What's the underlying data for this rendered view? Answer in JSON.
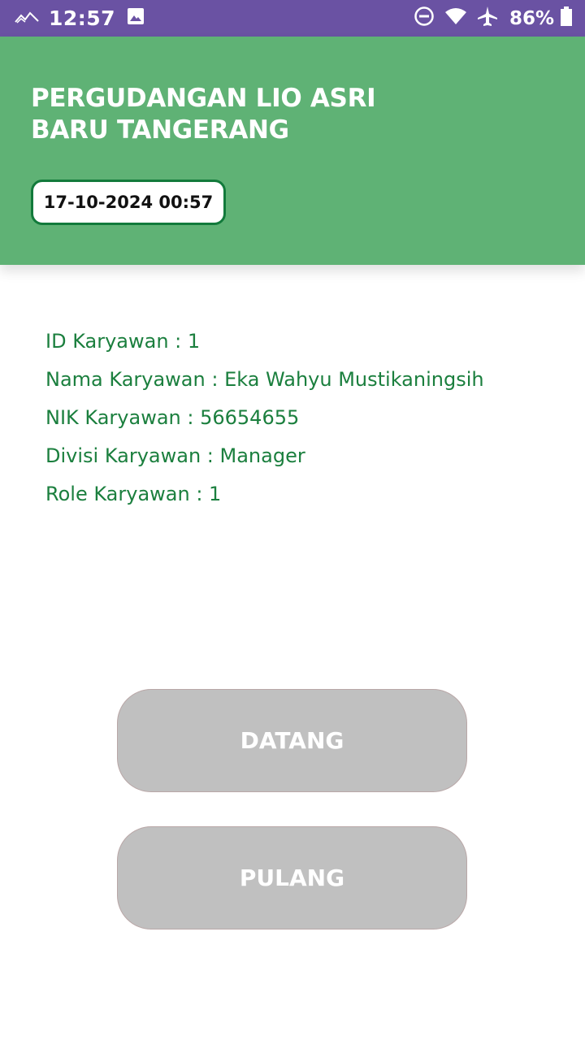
{
  "status_bar": {
    "time": "12:57",
    "battery_percent": "86%",
    "icons": [
      "signal-icon",
      "image-icon",
      "dnd-icon",
      "wifi-icon",
      "airplane-icon",
      "battery-icon"
    ],
    "background_color": "#6a52a3"
  },
  "header": {
    "title_line1": "PERGUDANGAN LIO ASRI",
    "title_line2": "BARU TANGERANG",
    "datetime": "17-10-2024 00:57",
    "background_color": "#5fb275",
    "pill_border_color": "#127a3b"
  },
  "employee": {
    "id_line": "ID Karyawan : 1",
    "name_line": "Nama Karyawan : Eka Wahyu Mustikaningsih",
    "nik_line": "NIK Karyawan : 56654655",
    "division_line": "Divisi Karyawan : Manager",
    "role_line": "Role Karyawan : 1",
    "text_color": "#1b7f3e"
  },
  "actions": {
    "datang_label": "DATANG",
    "pulang_label": "PULANG",
    "button_color": "#c0c0c0"
  }
}
